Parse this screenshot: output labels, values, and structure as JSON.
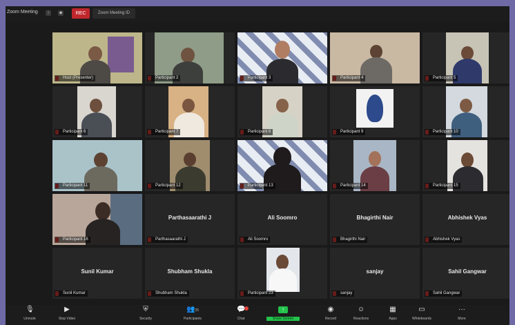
{
  "topbar": {
    "app_title": "Zoom Meeting",
    "record_label": "REC",
    "meeting_label": "Zoom Meeting ID"
  },
  "participants": [
    {
      "name": "Host (Presenter)",
      "video": true
    },
    {
      "name": "Participant 2",
      "video": true
    },
    {
      "name": "Participant 3",
      "video": true
    },
    {
      "name": "Participant 4",
      "video": true
    },
    {
      "name": "Participant 5",
      "video": true
    },
    {
      "name": "Participant 6",
      "video": true
    },
    {
      "name": "Participant 7",
      "video": true
    },
    {
      "name": "Participant 8",
      "video": true
    },
    {
      "name": "Participant 9",
      "video": true
    },
    {
      "name": "Participant 10",
      "video": true
    },
    {
      "name": "Participant 11",
      "video": true
    },
    {
      "name": "Participant 12",
      "video": true
    },
    {
      "name": "Participant 13",
      "video": true
    },
    {
      "name": "Participant 14",
      "video": true
    },
    {
      "name": "Participant 15",
      "video": true
    },
    {
      "name": "Participant 16",
      "video": true
    },
    {
      "name": "Parthasaarathi J",
      "video": false
    },
    {
      "name": "Ali Soomro",
      "video": false
    },
    {
      "name": "Bhagirthi Nair",
      "video": false
    },
    {
      "name": "Abhishek Vyas",
      "video": false
    },
    {
      "name": "Sunil Kumar",
      "video": false
    },
    {
      "name": "Shubham Shukla",
      "video": false
    },
    {
      "name": "Participant 23",
      "video": true
    },
    {
      "name": "sanjay",
      "video": false
    },
    {
      "name": "Sahil Gangwar",
      "video": false
    }
  ],
  "toolbar": {
    "unmute": "Unmute",
    "stop_video": "Stop Video",
    "security": "Security",
    "participants": "Participants",
    "participants_count": "25",
    "chat": "Chat",
    "share_screen": "Share Screen",
    "record": "Record",
    "reactions": "Reactions",
    "apps": "Apps",
    "whiteboards": "Whiteboards",
    "more": "More"
  },
  "colors": {
    "background": "#6f6aa6",
    "window": "#1a1a1a",
    "tile": "#262626",
    "active_border": "#b9c26b",
    "share_green": "#23c34c",
    "muted_red": "#e0403a"
  }
}
